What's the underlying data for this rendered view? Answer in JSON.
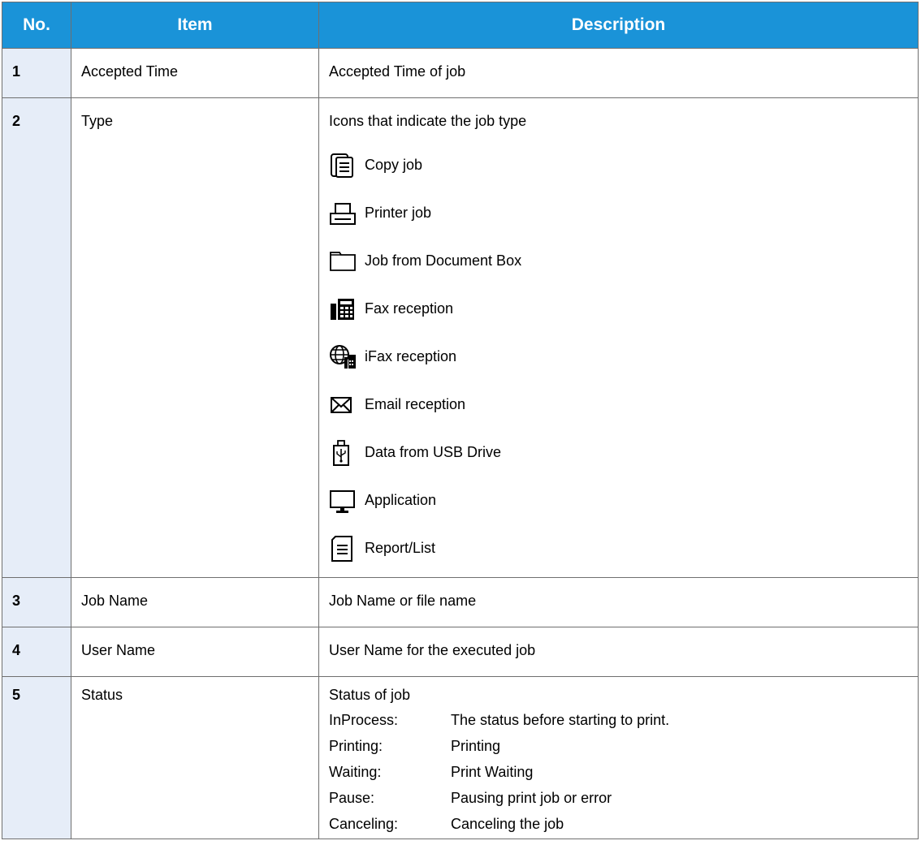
{
  "table": {
    "headers": {
      "no": "No.",
      "item": "Item",
      "description": "Description"
    },
    "rows": [
      {
        "no": "1",
        "item": "Accepted Time",
        "description": "Accepted Time of job"
      },
      {
        "no": "2",
        "item": "Type",
        "description": "Icons that indicate the job type",
        "types": [
          {
            "icon": "copy-icon",
            "label": "Copy job"
          },
          {
            "icon": "printer-icon",
            "label": "Printer job"
          },
          {
            "icon": "folder-icon",
            "label": "Job from Document Box"
          },
          {
            "icon": "fax-icon",
            "label": "Fax reception"
          },
          {
            "icon": "globe-fax-icon",
            "label": "iFax reception"
          },
          {
            "icon": "envelope-icon",
            "label": "Email reception"
          },
          {
            "icon": "usb-drive-icon",
            "label": "Data from USB Drive"
          },
          {
            "icon": "monitor-icon",
            "label": "Application"
          },
          {
            "icon": "report-icon",
            "label": "Report/List"
          }
        ]
      },
      {
        "no": "3",
        "item": "Job Name",
        "description": "Job Name or file name"
      },
      {
        "no": "4",
        "item": "User Name",
        "description": "User Name for the executed job"
      },
      {
        "no": "5",
        "item": "Status",
        "description": "Status of job",
        "statuses": [
          {
            "term": "InProcess:",
            "text": "The status before starting to print."
          },
          {
            "term": "Printing:",
            "text": "Printing"
          },
          {
            "term": "Waiting:",
            "text": "Print Waiting"
          },
          {
            "term": "Pause:",
            "text": "Pausing print job or error"
          },
          {
            "term": "Canceling:",
            "text": "Canceling the job"
          }
        ]
      }
    ]
  },
  "colors": {
    "header_bg": "#1a93d8",
    "no_col_bg": "#e6edf8",
    "border": "#6f6f6f"
  }
}
